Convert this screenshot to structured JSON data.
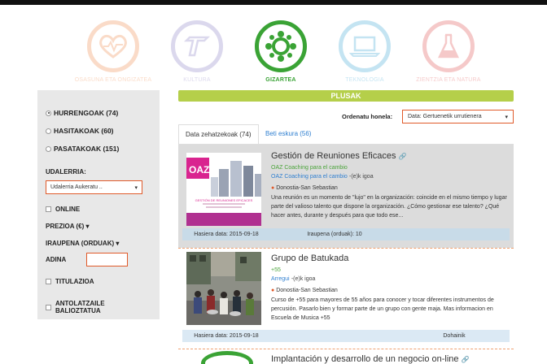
{
  "categories": [
    {
      "label": "OSASUNA ETA ONGIZATEA",
      "icon": "heart-pulse-icon",
      "color": "#f08a4b",
      "active": false
    },
    {
      "label": "KULTURA",
      "icon": "culture-icon",
      "color": "#8a7fc4",
      "active": false
    },
    {
      "label": "GIZARTEA",
      "icon": "people-network-icon",
      "color": "#3aa335",
      "active": true
    },
    {
      "label": "TEKNOLOGIA",
      "icon": "laptop-icon",
      "color": "#3fa8d6",
      "active": false
    },
    {
      "label": "ZIENTZIA ETA NATURA",
      "icon": "flask-icon",
      "color": "#e05050",
      "active": false
    }
  ],
  "sidebar": {
    "radios": [
      {
        "label": "HURRENGOAK (74)",
        "selected": true
      },
      {
        "label": "HASITAKOAK (60)",
        "selected": false
      },
      {
        "label": "PASATAKOAK (151)",
        "selected": false
      }
    ],
    "udalerria_label": "UDALERRIA:",
    "udalerria_select": "Udalerria Aukeratu ..",
    "online_label": "ONLINE",
    "prezioa_label": "PREZIOA (€)",
    "iraupena_label": "IRAUPENA (ORDUAK)",
    "adina_label": "ADINA",
    "titulazioa_label": "TITULAZIOA",
    "antolatzaile_label": "ANTOLATZAILE BALIOZTATUA"
  },
  "main": {
    "header": "PLUSAK",
    "sort_label": "Ordenatu honela:",
    "sort_value": "Data: Gertuenetik urrutienera",
    "tabs": [
      {
        "label": "Data zehatzekoak (74)",
        "active": true
      },
      {
        "label": "Beti eskura (56)",
        "active": false
      }
    ]
  },
  "cards": [
    {
      "title": "Gestión de Reuniones Eficaces",
      "org_line1": "OAZ Coaching para el cambio",
      "org_line2_link": "OAZ Coaching para el cambio",
      "org_line2_suffix": "-(e)k igoa",
      "location": "Donostia-San Sebastian",
      "description": "Una reunión es un momento de \"lujo\" en la organización: coincide en el mismo tiempo y lugar parte del valioso talento que dispone la organización. ¿Cómo gestionar ese talento? ¿Qué hacer antes, durante y después para que todo ese...",
      "image_brand": "OAZ",
      "image_caption": "GESTIÓN DE REUNIONES EFICACES",
      "meta": [
        "Hasiera data: 2015-09-18",
        "Iraupena (orduak): 10",
        ""
      ]
    },
    {
      "title": "Grupo de Batukada",
      "org_line1": "+55",
      "org_line2_link": "Arregui",
      "org_line2_suffix": "-(e)k igoa",
      "location": "Donostia-San Sebastian",
      "description": "Curso de +55 para mayores de 55 años para conocer y tocar diferentes instrumentos de percusión. Pasarlo bien y formar parte de un grupo con gente maja. Mas informacion en Escuela de Musica +55",
      "meta": [
        "Hasiera data: 2015-09-18",
        "",
        "Dohainik"
      ]
    },
    {
      "title": "Implantación y desarrollo de un negocio on-line"
    }
  ]
}
